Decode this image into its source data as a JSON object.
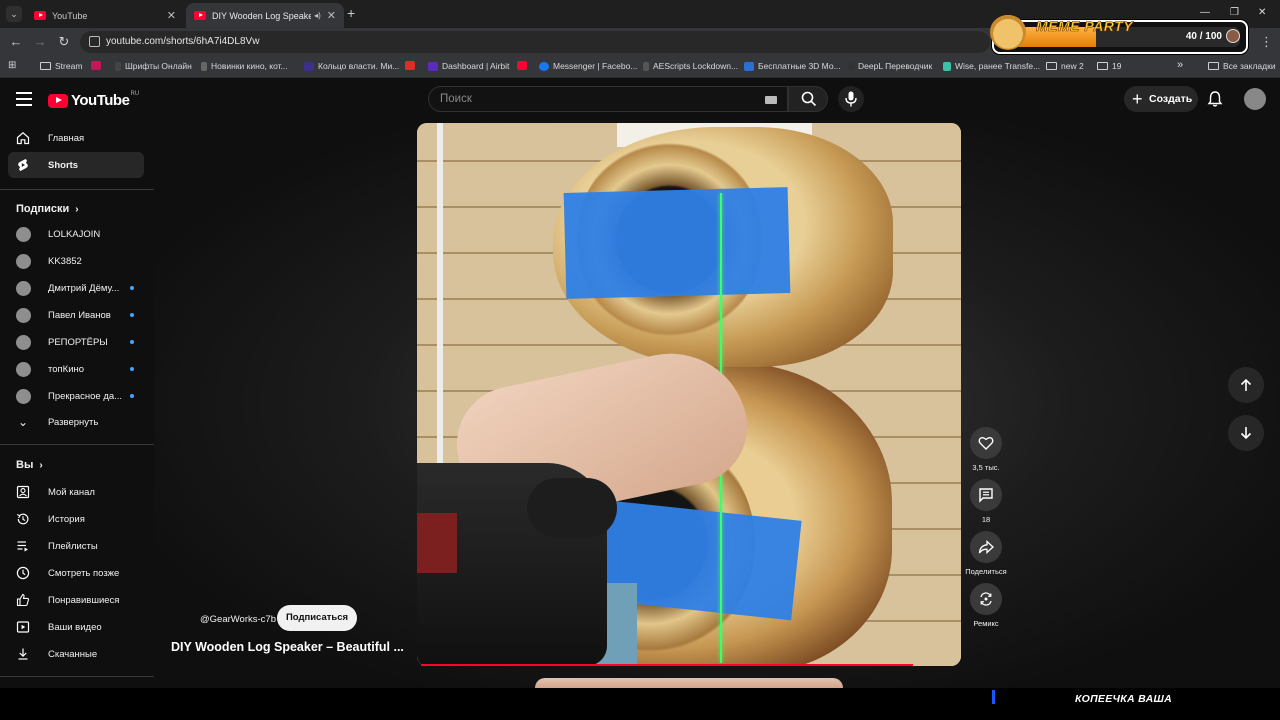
{
  "browser": {
    "tabs": [
      {
        "title": "YouTube",
        "active": false
      },
      {
        "title": "DIY Wooden Log Speaker –",
        "active": true
      }
    ],
    "url": "youtube.com/shorts/6hA7i4DL8Vw",
    "bookmarks": [
      {
        "label": "Stream",
        "type": "folder"
      },
      {
        "label": "Шрифты Онлайн",
        "type": "link"
      },
      {
        "label": "Новинки кино, кот...",
        "type": "link"
      },
      {
        "label": "Кольцо власти. Ми...",
        "type": "link"
      },
      {
        "label": "Dashboard | Airbit",
        "type": "link"
      },
      {
        "label": "Messenger | Facebo...",
        "type": "link"
      },
      {
        "label": "AEScripts Lockdown...",
        "type": "link"
      },
      {
        "label": "Бесплатные 3D Мо...",
        "type": "link"
      },
      {
        "label": "DeepL Переводчик",
        "type": "link"
      },
      {
        "label": "Wise, ранее Transfe...",
        "type": "link"
      },
      {
        "label": "new 2",
        "type": "folder"
      },
      {
        "label": "19",
        "type": "folder"
      }
    ],
    "all_bookmarks": "Все закладки",
    "more_bookmarks": "»"
  },
  "meme_party": {
    "logo": "MEME PARTY",
    "count_text": "40 / 100",
    "progress": 0.4
  },
  "youtube": {
    "logo": "YouTube",
    "country": "RU",
    "search_placeholder": "Поиск",
    "create_label": "Создать",
    "sidebar": {
      "main": [
        {
          "label": "Главная",
          "icon": "home-icon",
          "active": false
        },
        {
          "label": "Shorts",
          "icon": "shorts-icon",
          "active": true
        }
      ],
      "subscriptions_header": "Подписки",
      "subscriptions": [
        {
          "label": "LOLKAJOIN",
          "new": false
        },
        {
          "label": "KK3852",
          "new": false
        },
        {
          "label": "Дмитрий Дёму...",
          "new": true
        },
        {
          "label": "Павел Иванов",
          "new": true
        },
        {
          "label": "РЕПОРТЁРЫ",
          "new": true
        },
        {
          "label": "топКино",
          "new": true
        },
        {
          "label": "Прекрасное да...",
          "new": true
        }
      ],
      "expand_label": "Развернуть",
      "you_header": "Вы",
      "you_items": [
        {
          "label": "Мой канал",
          "icon": "my-channel-icon"
        },
        {
          "label": "История",
          "icon": "history-icon"
        },
        {
          "label": "Плейлисты",
          "icon": "playlists-icon"
        },
        {
          "label": "Смотреть позже",
          "icon": "watch-later-icon"
        },
        {
          "label": "Понравившиеся",
          "icon": "liked-icon"
        },
        {
          "label": "Ваши видео",
          "icon": "your-videos-icon"
        },
        {
          "label": "Скачанные",
          "icon": "downloads-icon"
        }
      ]
    },
    "short": {
      "channel": "@GearWorks-c7b",
      "subscribe_label": "Подписаться",
      "title": "DIY Wooden Log Speaker – Beautiful ...",
      "likes": "3,5 тыс.",
      "comments": "18",
      "share_label": "Поделиться",
      "remix_label": "Ремикс"
    }
  },
  "overlay": {
    "bottom_text": "КОПЕЕЧКА ВАША"
  }
}
